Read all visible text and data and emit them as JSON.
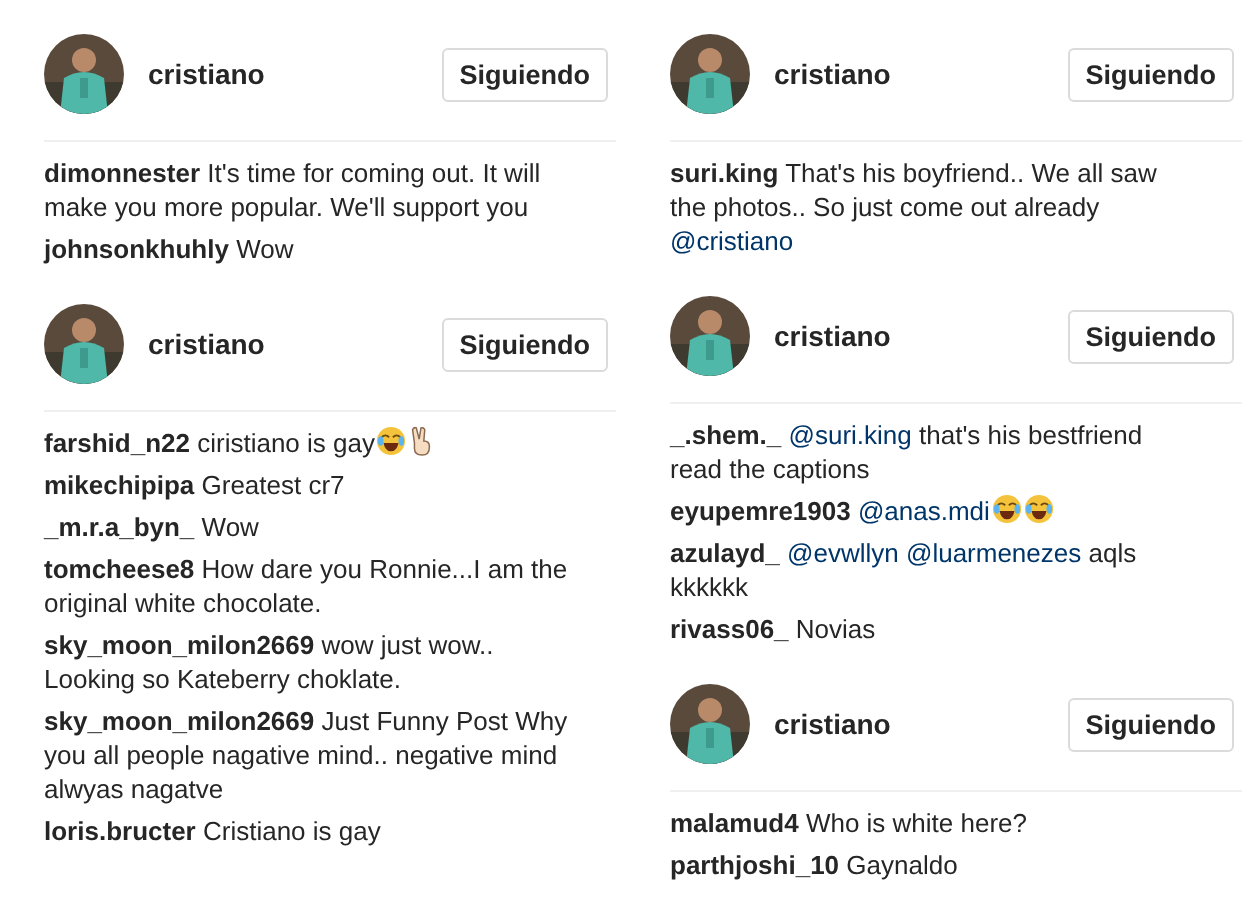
{
  "columns": [
    {
      "panels": [
        {
          "account": "cristiano",
          "follow_button": "Siguiendo",
          "comments": [
            {
              "user": "dimonnester",
              "parts": [
                {
                  "kind": "text",
                  "text": "It's time for coming out. It will make you more popular. We'll support you"
                }
              ]
            },
            {
              "user": "johnsonkhuhly",
              "parts": [
                {
                  "kind": "text",
                  "text": "Wow"
                }
              ]
            }
          ]
        },
        {
          "account": "cristiano",
          "follow_button": "Siguiendo",
          "comments": [
            {
              "user": "farshid_n22",
              "parts": [
                {
                  "kind": "text",
                  "text": "ciristiano is gay"
                },
                {
                  "kind": "laugh_emoji"
                },
                {
                  "kind": "victory_emoji"
                }
              ]
            },
            {
              "user": "mikechipipa",
              "parts": [
                {
                  "kind": "text",
                  "text": "Greatest cr7"
                }
              ]
            },
            {
              "user": "_m.r.a_byn_",
              "parts": [
                {
                  "kind": "text",
                  "text": "Wow"
                }
              ]
            },
            {
              "user": "tomcheese8",
              "parts": [
                {
                  "kind": "text",
                  "text": "How dare you Ronnie...I am the original white chocolate."
                }
              ]
            },
            {
              "user": "sky_moon_milon2669",
              "parts": [
                {
                  "kind": "text",
                  "text": "wow just wow.. Looking so Kateberry choklate."
                }
              ]
            },
            {
              "user": "sky_moon_milon2669",
              "parts": [
                {
                  "kind": "text",
                  "text": "Just Funny Post Why you all people nagative mind.. negative mind alwyas nagatve"
                }
              ]
            },
            {
              "user": "loris.bructer",
              "parts": [
                {
                  "kind": "text",
                  "text": "Cristiano is gay"
                }
              ]
            }
          ]
        }
      ]
    },
    {
      "panels": [
        {
          "account": "cristiano",
          "follow_button": "Siguiendo",
          "comments": [
            {
              "user": "suri.king",
              "parts": [
                {
                  "kind": "text",
                  "text": "That's his boyfriend.. We all saw the photos.. So just come out already"
                },
                {
                  "kind": "mention",
                  "text": "@cristiano"
                }
              ]
            }
          ]
        },
        {
          "account": "cristiano",
          "follow_button": "Siguiendo",
          "comments": [
            {
              "user": "_.shem._",
              "parts": [
                {
                  "kind": "mention",
                  "text": "@suri.king"
                },
                {
                  "kind": "text",
                  "text": "that's his bestfriend read the captions"
                }
              ]
            },
            {
              "user": "eyupemre1903",
              "parts": [
                {
                  "kind": "mention",
                  "text": "@anas.mdi"
                },
                {
                  "kind": "laugh_emoji"
                },
                {
                  "kind": "laugh_emoji"
                }
              ]
            },
            {
              "user": "azulayd_",
              "parts": [
                {
                  "kind": "mention",
                  "text": "@evwllyn"
                },
                {
                  "kind": "mention",
                  "text": "@luarmenezes"
                },
                {
                  "kind": "text",
                  "text": "aqls kkkkkk"
                }
              ]
            },
            {
              "user": "rivass06_",
              "parts": [
                {
                  "kind": "text",
                  "text": "Novias"
                }
              ]
            }
          ]
        },
        {
          "account": "cristiano",
          "follow_button": "Siguiendo",
          "comments": [
            {
              "user": "malamud4",
              "parts": [
                {
                  "kind": "text",
                  "text": "Who is white here?"
                }
              ]
            },
            {
              "user": "parthjoshi_10",
              "parts": [
                {
                  "kind": "text",
                  "text": "Gaynaldo"
                }
              ]
            }
          ]
        }
      ]
    }
  ]
}
